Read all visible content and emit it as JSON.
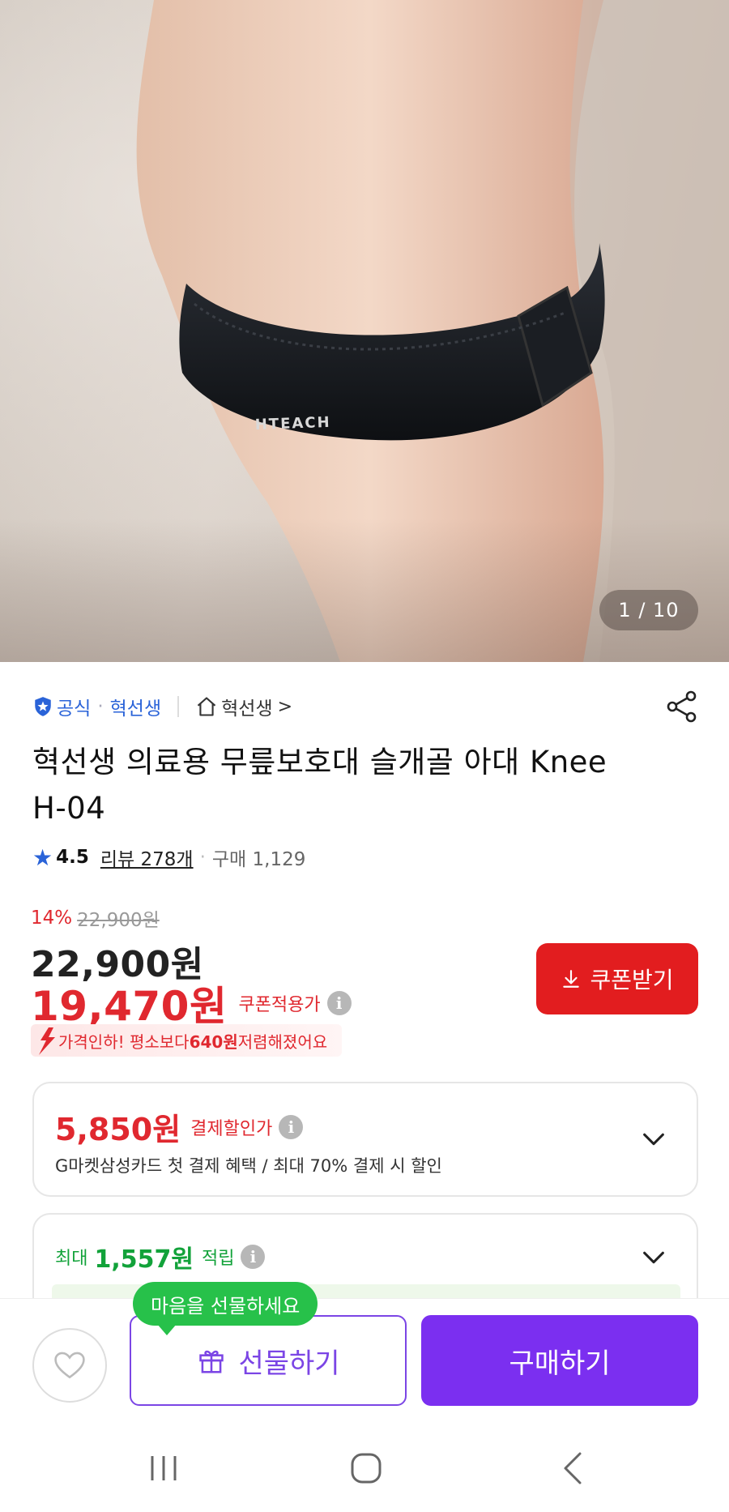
{
  "gallery": {
    "counter": "1 / 10",
    "brand_on_product": "HTEACH"
  },
  "seller": {
    "official_label": "공식",
    "dot": "·",
    "seller_name": "혁선생",
    "store_name": "혁선생",
    "store_chevron": ">"
  },
  "product": {
    "title": "혁선생 의료용 무릎보호대 슬개골 아대 Knee H-04"
  },
  "rating": {
    "score": "4.5",
    "review_label": "리뷰 278개",
    "dot": "·",
    "purchase_label": "구매 1,129"
  },
  "price": {
    "discount_pct": "14%",
    "original_strike": "22,900원",
    "sale_price": "22,900원",
    "coupon_price": "19,470원",
    "coupon_price_label": "쿠폰적용가",
    "coupon_button": "쿠폰받기",
    "drop_banner_prefix": "가격인하! 평소보다 ",
    "drop_banner_amount": "640원",
    "drop_banner_suffix": " 저렴해졌어요"
  },
  "payment_card": {
    "amount": "5,850원",
    "label": "결제할인가",
    "description": "G마켓삼성카드 첫 결제 혜택 / 최대 70% 결제 시 할인"
  },
  "points_card": {
    "prefix": "최대",
    "amount": "1,557원",
    "suffix": "적립"
  },
  "bottom_bar": {
    "gift_tooltip": "마음을 선물하세요",
    "gift_button": "선물하기",
    "buy_button": "구매하기"
  },
  "colors": {
    "accent_red": "#e0282f",
    "purple": "#7b2ff0",
    "green": "#27c14a",
    "blue": "#2a63d8"
  },
  "icons": [
    "shield-icon",
    "home-icon",
    "share-icon",
    "star-icon",
    "info-icon",
    "download-icon",
    "price-drop-arrow-icon",
    "chevron-down-icon",
    "heart-icon",
    "gift-icon",
    "nav-recent-icon",
    "nav-home-icon",
    "nav-back-icon"
  ]
}
